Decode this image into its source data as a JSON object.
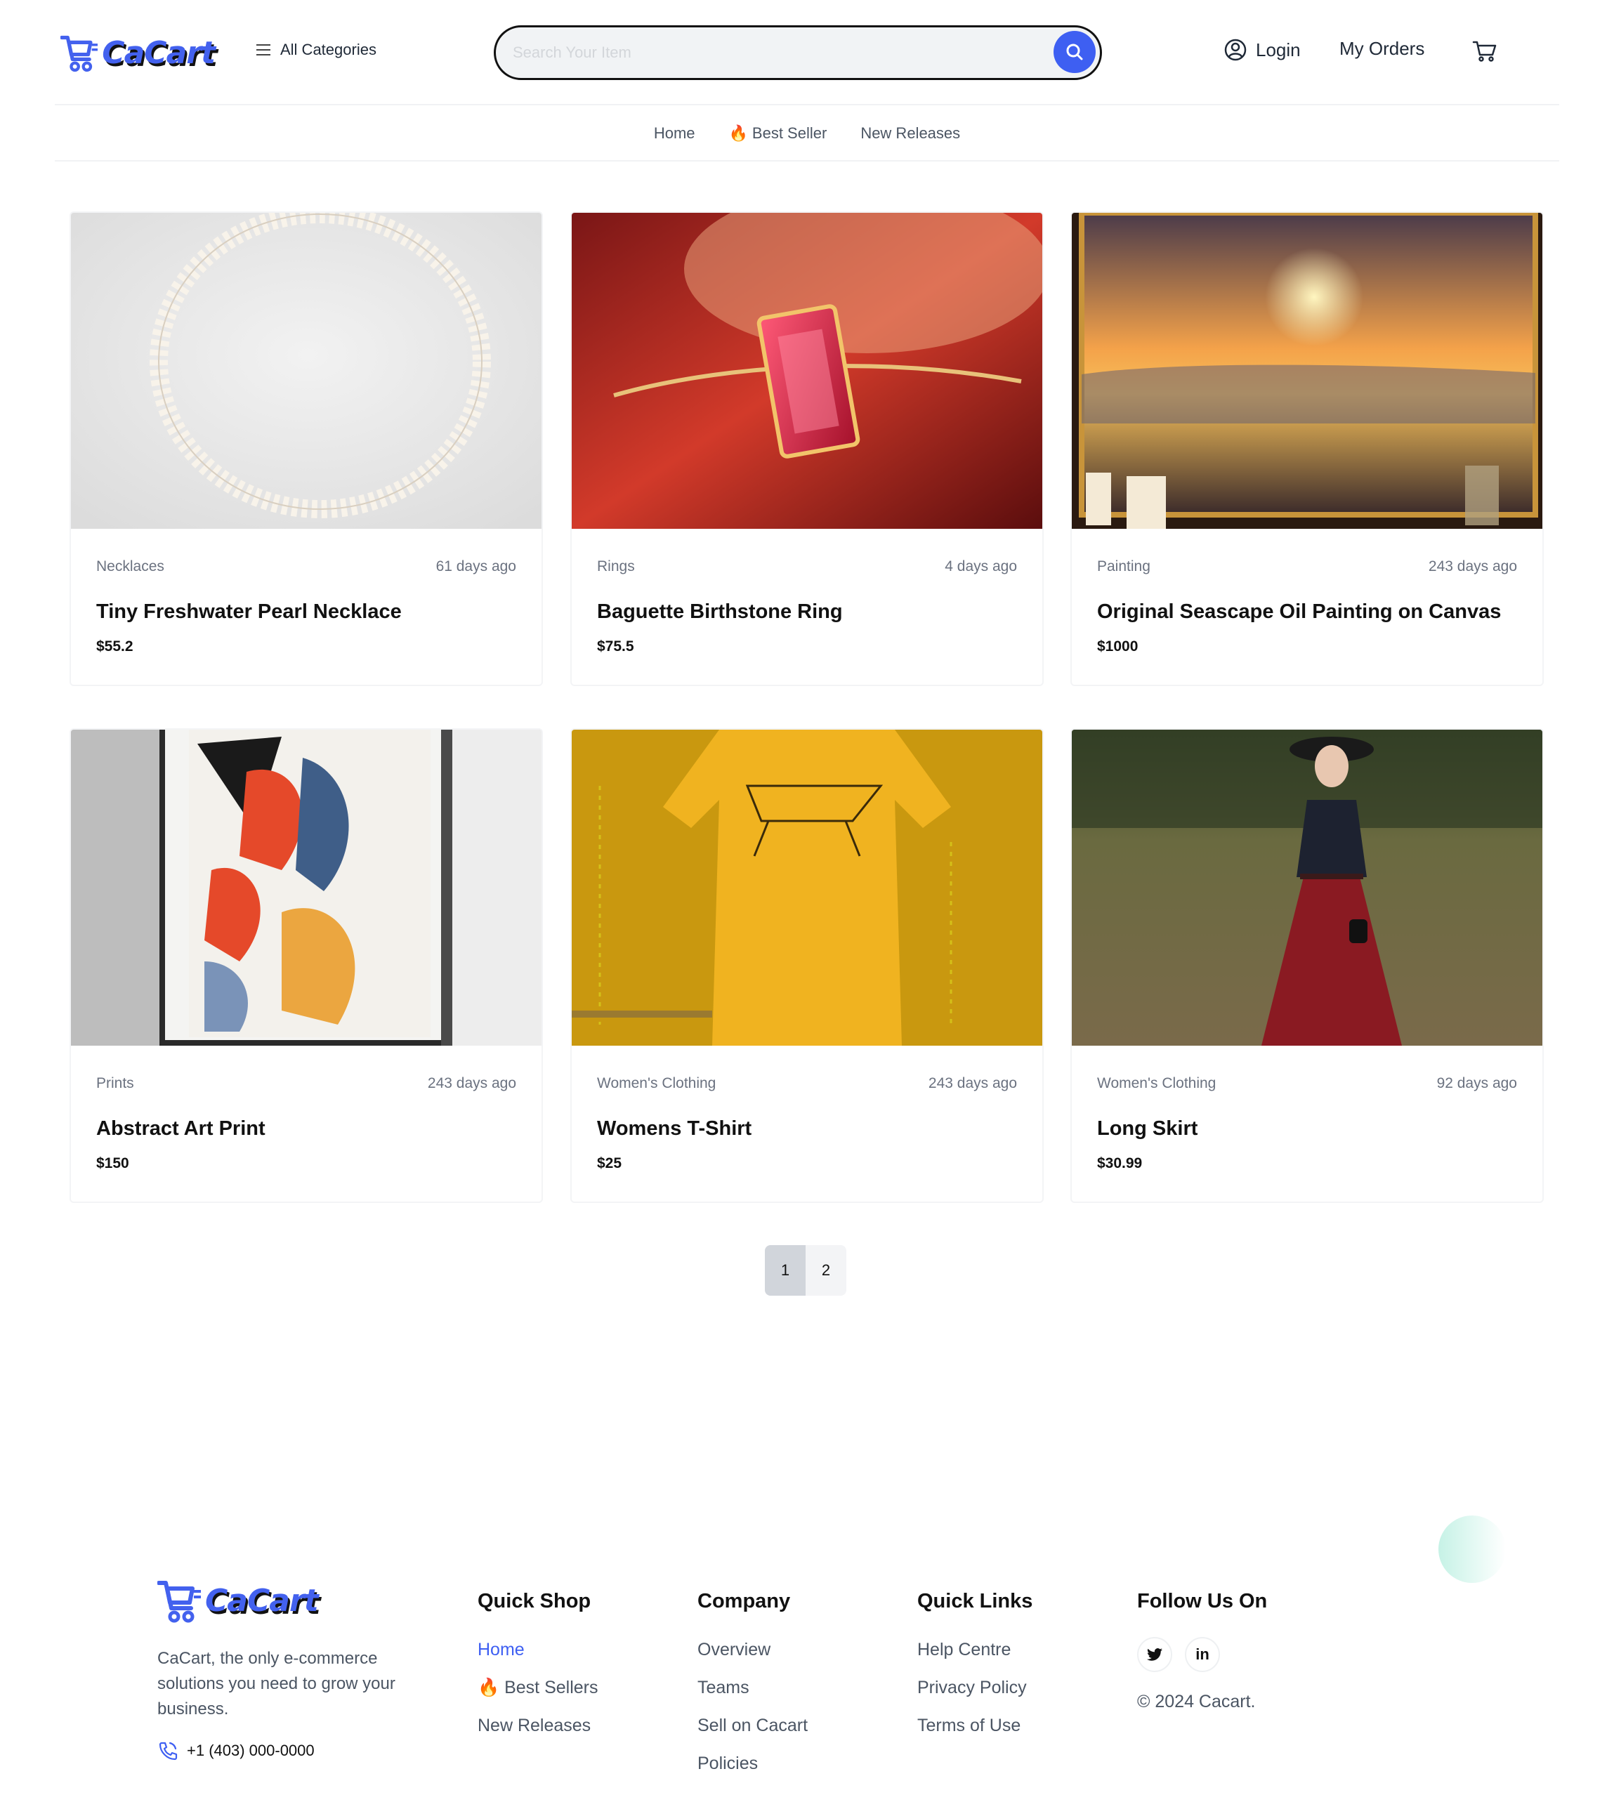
{
  "brand": {
    "name": "CaCart",
    "accent": "#3e5ff2"
  },
  "header": {
    "all_categories": "All Categories",
    "search_placeholder": "Search Your Item",
    "login": "Login",
    "my_orders": "My Orders"
  },
  "nav": {
    "home": "Home",
    "best_seller": "Best Seller",
    "new_releases": "New Releases"
  },
  "products": [
    {
      "category": "Necklaces",
      "age": "61 days ago",
      "title": "Tiny Freshwater Pearl Necklace",
      "price": "$55.2"
    },
    {
      "category": "Rings",
      "age": "4 days ago",
      "title": "Baguette Birthstone Ring",
      "price": "$75.5"
    },
    {
      "category": "Painting",
      "age": "243 days ago",
      "title": "Original Seascape Oil Painting on Canvas",
      "price": "$1000"
    },
    {
      "category": "Prints",
      "age": "243 days ago",
      "title": "Abstract Art Print",
      "price": "$150"
    },
    {
      "category": "Women's Clothing",
      "age": "243 days ago",
      "title": "Womens T-Shirt",
      "price": "$25"
    },
    {
      "category": "Women's Clothing",
      "age": "92 days ago",
      "title": "Long Skirt",
      "price": "$30.99"
    }
  ],
  "pagination": {
    "pages": [
      "1",
      "2"
    ],
    "current": "1"
  },
  "footer": {
    "description": "CaCart, the only e-commerce solutions you need to grow your business.",
    "phone": "+1 (403) 000-0000",
    "quick_shop": {
      "heading": "Quick Shop",
      "links": [
        "Home",
        "Best Sellers",
        "New Releases"
      ]
    },
    "company": {
      "heading": "Company",
      "links": [
        "Overview",
        "Teams",
        "Sell on Cacart",
        "Policies"
      ]
    },
    "quick_links": {
      "heading": "Quick Links",
      "links": [
        "Help Centre",
        "Privacy Policy",
        "Terms of Use"
      ]
    },
    "follow": {
      "heading": "Follow Us On",
      "twitter": "twitter-icon",
      "linkedin": "in"
    },
    "copyright": "© 2024 Cacart."
  }
}
